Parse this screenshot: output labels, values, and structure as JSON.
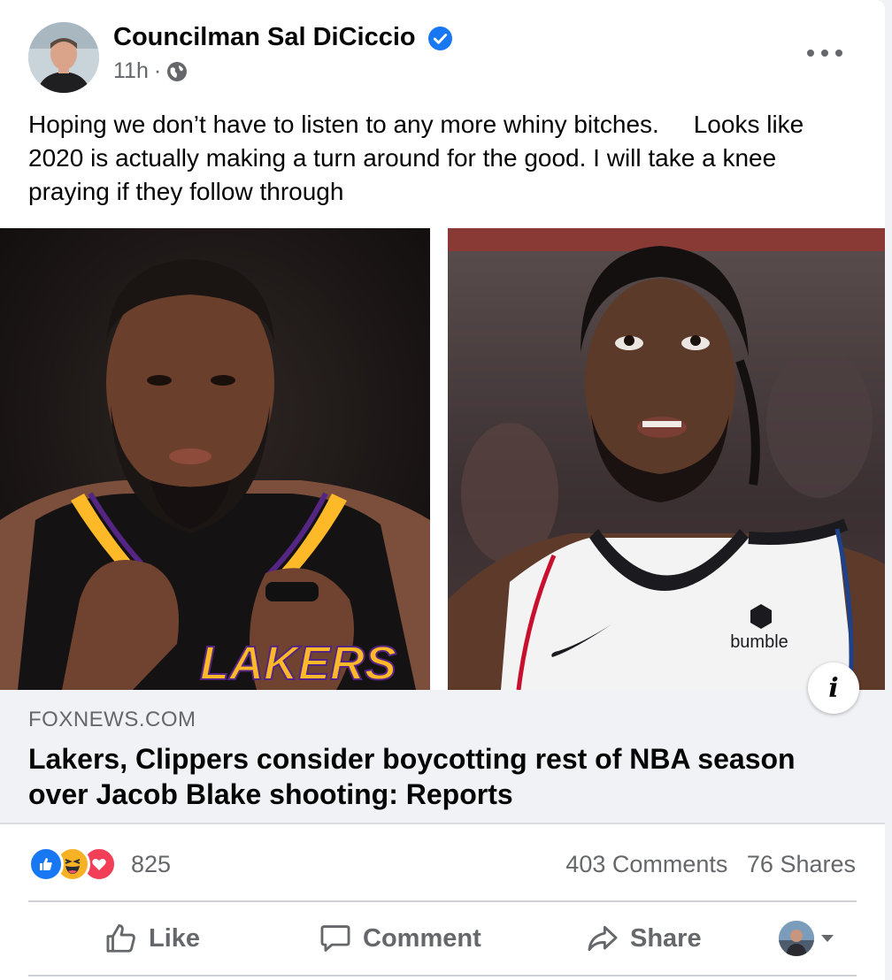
{
  "post": {
    "author": "Councilman Sal DiCiccio",
    "verified_icon": "verified-badge-icon",
    "time": "11h",
    "separator": "·",
    "audience_icon": "globe-icon",
    "more_icon": "more-options-icon",
    "text": "Hoping we don’t have to listen to any more whiny bitches.     Looks like 2020 is actually making a turn around for the good. I will take a knee praying if they follow through"
  },
  "link": {
    "domain": "FOXNEWS.COM",
    "title": "Lakers, Clippers consider boycotting rest of NBA season over Jacob Blake shooting: Reports",
    "info_label": "i",
    "left_jersey_text": "LAKERS",
    "right_jersey_text": "bumble"
  },
  "stats": {
    "reaction_icons": [
      "like-reaction-icon",
      "haha-reaction-icon",
      "love-reaction-icon"
    ],
    "reaction_count": "825",
    "comments": "403 Comments",
    "shares": "76 Shares"
  },
  "actions": {
    "like": "Like",
    "comment": "Comment",
    "share": "Share"
  },
  "colors": {
    "accent": "#1877f2",
    "secondary_text": "#65676b",
    "link_bg": "#f0f2f5",
    "lakers_purple": "#552583",
    "lakers_gold": "#fdb927"
  }
}
